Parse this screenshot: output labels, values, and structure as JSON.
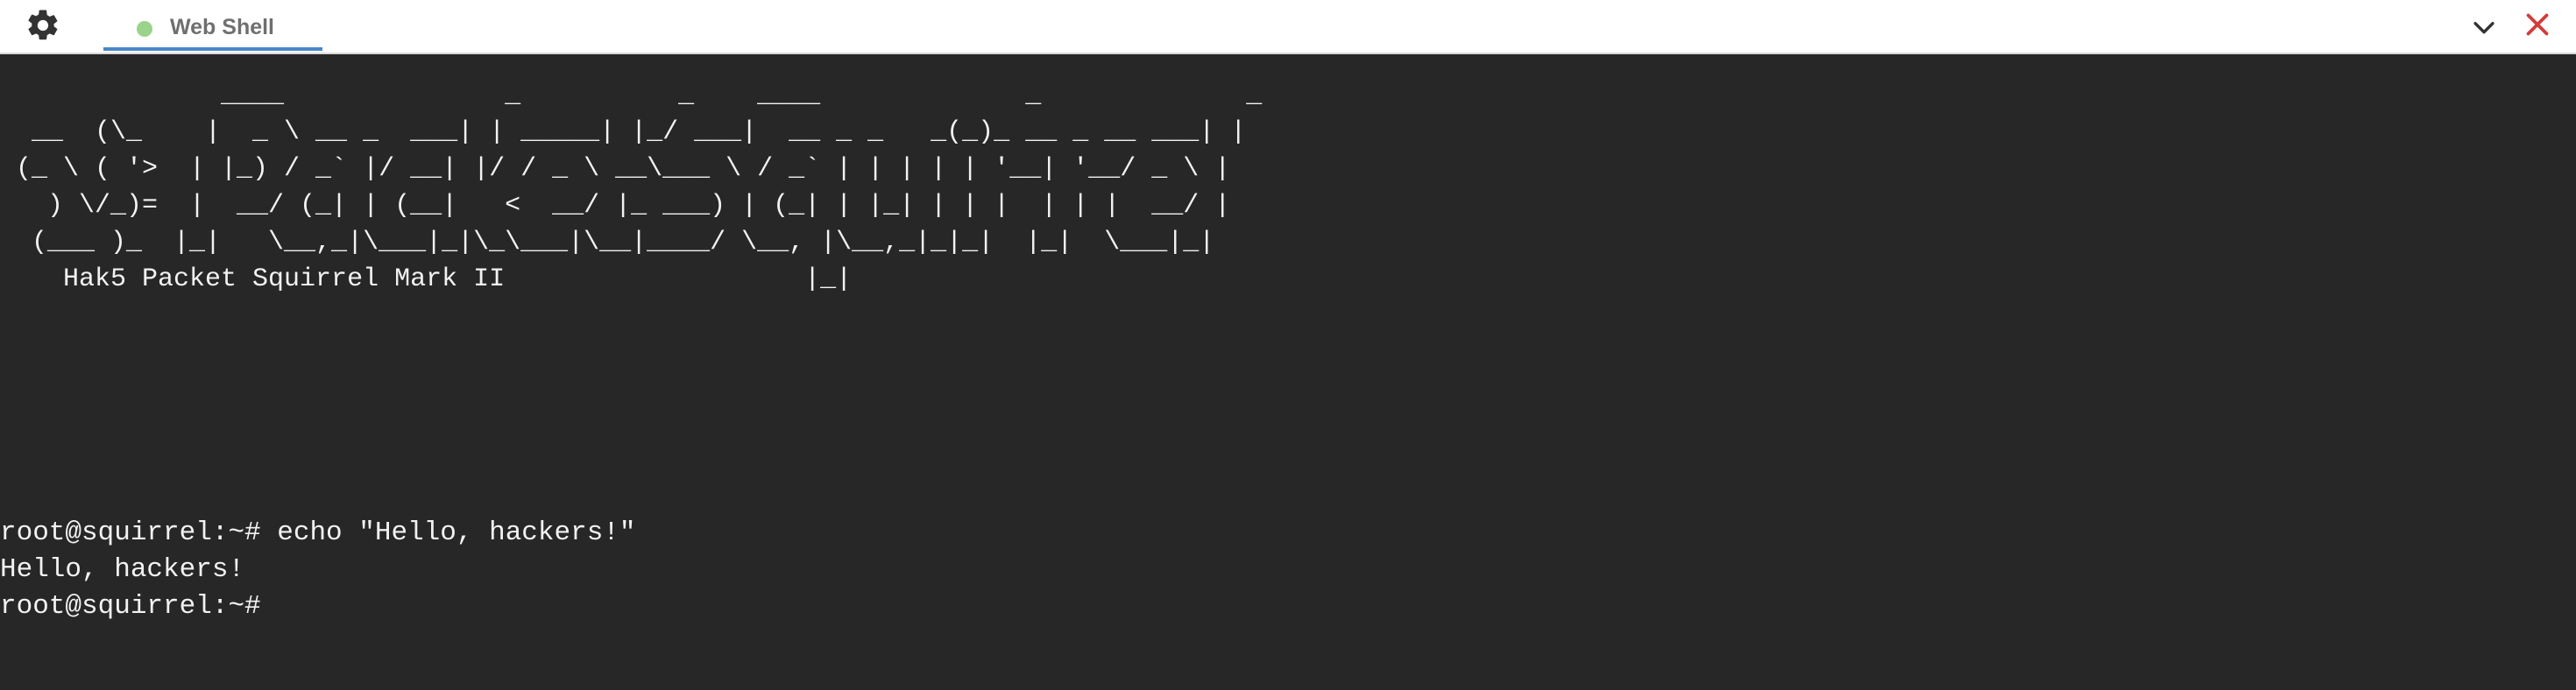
{
  "window": {
    "tab_label": "Web Shell",
    "tab_status": "connected",
    "accent_color": "#4a86c8",
    "status_color": "#9ad48a",
    "close_color": "#d33c3c",
    "terminal_bg": "#272727"
  },
  "icons": {
    "settings": "gear-icon",
    "collapse": "chevron-down-icon",
    "close": "close-icon"
  },
  "terminal": {
    "banner": "              ____              _          _    ____             _             _\n  __  (\\_    |  _ \\ __ _  ___| | _____| |_/ ___|  __ _ _   _(_)_ __ _ __ ___| |\n (_ \\ ( '>  | |_) / _` |/ __| |/ / _ \\ __\\___ \\ / _` | | | | | '__| '__/ _ \\ |\n   ) \\/_)=  |  __/ (_| | (__|   <  __/ |_ ___) | (_| | |_| | | |  | | |  __/ |\n  (___ )_  |_|   \\__,_|\\___|_|\\_\\___|\\__|____/ \\__, |\\__,_|_|_|  |_|  \\___|_|\n    Hak5 Packet Squirrel Mark II                   |_|",
    "lines": [
      "root@squirrel:~# echo \"Hello, hackers!\"",
      "Hello, hackers!",
      "root@squirrel:~#"
    ]
  }
}
